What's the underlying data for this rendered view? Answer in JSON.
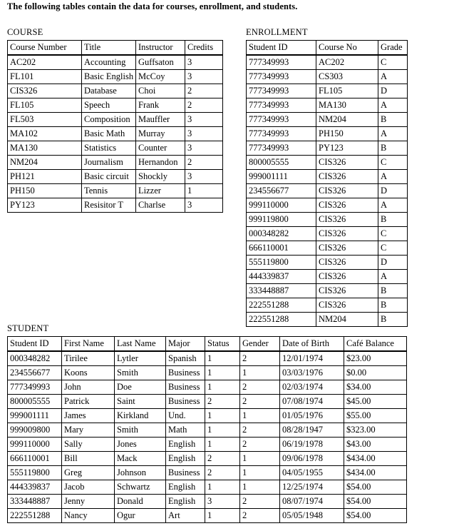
{
  "intro": "The following tables contain the data for courses, enrollment, and students.",
  "course": {
    "label": "COURSE",
    "columns": [
      "Course Number",
      "Title",
      "Instructor",
      "Credits"
    ],
    "rows": [
      [
        "AC202",
        "Accounting",
        "Guffsaton",
        "3"
      ],
      [
        "FL101",
        "Basic English",
        "McCoy",
        "3"
      ],
      [
        "CIS326",
        "Database",
        "Choi",
        "2"
      ],
      [
        "FL105",
        "Speech",
        "Frank",
        "2"
      ],
      [
        "FL503",
        "Composition",
        "Mauffler",
        "3"
      ],
      [
        "MA102",
        "Basic Math",
        "Murray",
        "3"
      ],
      [
        "MA130",
        "Statistics",
        "Counter",
        "3"
      ],
      [
        "NM204",
        "Journalism",
        "Hernandon",
        "2"
      ],
      [
        "PH121",
        "Basic circuit",
        "Shockly",
        "3"
      ],
      [
        "PH150",
        "Tennis",
        "Lizzer",
        "1"
      ],
      [
        "PY123",
        "Resisitor T",
        "Charlse",
        "3"
      ]
    ]
  },
  "enrollment": {
    "label": "ENROLLMENT",
    "columns": [
      "Student ID",
      "Course No",
      "Grade"
    ],
    "rows": [
      [
        "777349993",
        "AC202",
        "C"
      ],
      [
        "777349993",
        "CS303",
        "A"
      ],
      [
        "777349993",
        "FL105",
        "D"
      ],
      [
        "777349993",
        "MA130",
        "A"
      ],
      [
        "777349993",
        "NM204",
        "B"
      ],
      [
        "777349993",
        "PH150",
        "A"
      ],
      [
        "777349993",
        "PY123",
        "B"
      ],
      [
        "800005555",
        "CIS326",
        "C"
      ],
      [
        "999001111",
        "CIS326",
        "A"
      ],
      [
        "234556677",
        "CIS326",
        "D"
      ],
      [
        "999110000",
        "CIS326",
        "A"
      ],
      [
        "999119800",
        "CIS326",
        "B"
      ],
      [
        "000348282",
        "CIS326",
        "C"
      ],
      [
        "666110001",
        "CIS326",
        "C"
      ],
      [
        "555119800",
        "CIS326",
        "D"
      ],
      [
        "444339837",
        "CIS326",
        "A"
      ],
      [
        "333448887",
        "CIS326",
        "B"
      ],
      [
        "222551288",
        "CIS326",
        "B"
      ],
      [
        "222551288",
        "NM204",
        "B"
      ]
    ]
  },
  "student": {
    "label": "STUDENT",
    "columns": [
      "Student ID",
      "First Name",
      "Last Name",
      "Major",
      "Status",
      "Gender",
      "Date of Birth",
      "Café Balance"
    ],
    "rows": [
      [
        "000348282",
        "Tirilee",
        "Lytler",
        "Spanish",
        "1",
        "2",
        "12/01/1974",
        "$23.00"
      ],
      [
        "234556677",
        "Koons",
        "Smith",
        "Business",
        "1",
        "1",
        "03/03/1976",
        "$0.00"
      ],
      [
        "777349993",
        "John",
        "Doe",
        "Business",
        "1",
        "2",
        "02/03/1974",
        "$34.00"
      ],
      [
        "800005555",
        "Patrick",
        "Saint",
        "Business",
        "2",
        "2",
        "07/08/1974",
        "$45.00"
      ],
      [
        "999001111",
        "James",
        "Kirkland",
        "Und.",
        "1",
        "1",
        "01/05/1976",
        "$55.00"
      ],
      [
        "999009800",
        "Mary",
        "Smith",
        "Math",
        "1",
        "2",
        "08/28/1947",
        "$323.00"
      ],
      [
        "999110000",
        "Sally",
        "Jones",
        "English",
        "1",
        "2",
        "06/19/1978",
        "$43.00"
      ],
      [
        "666110001",
        "Bill",
        "Mack",
        "English",
        "2",
        "1",
        "09/06/1978",
        "$434.00"
      ],
      [
        "555119800",
        "Greg",
        "Johnson",
        "Business",
        "2",
        "1",
        "04/05/1955",
        "$434.00"
      ],
      [
        "444339837",
        "Jacob",
        "Schwartz",
        "English",
        "1",
        "1",
        "12/25/1974",
        "$54.00"
      ],
      [
        "333448887",
        "Jenny",
        "Donald",
        "English",
        "3",
        "2",
        "08/07/1974",
        "$54.00"
      ],
      [
        "222551288",
        "Nancy",
        "Ogur",
        "Art",
        "1",
        "2",
        "05/05/1948",
        "$54.00"
      ]
    ]
  }
}
